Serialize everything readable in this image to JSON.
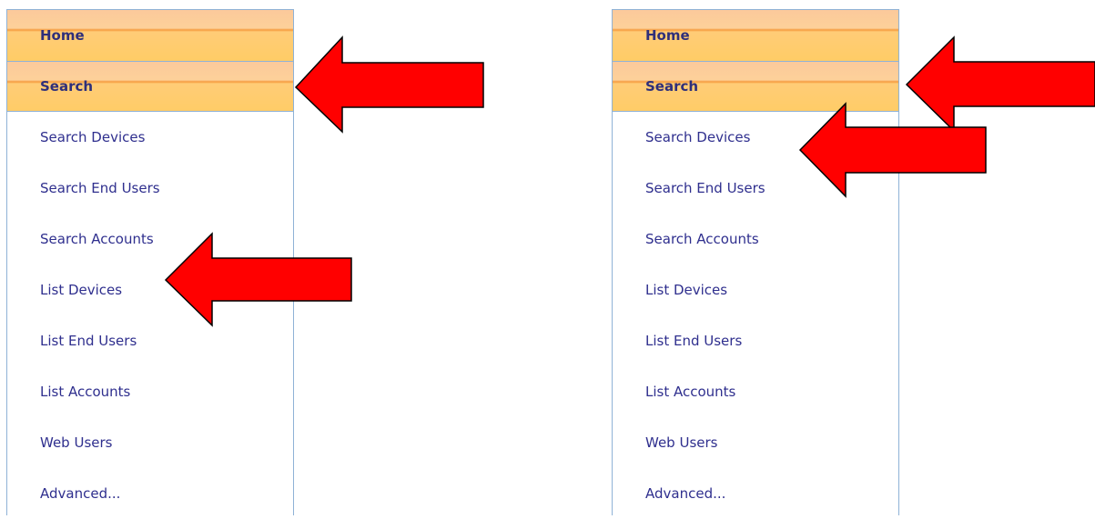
{
  "left_menu": {
    "headers": [
      {
        "label": "Home"
      },
      {
        "label": "Search"
      }
    ],
    "items": [
      {
        "label": "Search Devices"
      },
      {
        "label": "Search End Users"
      },
      {
        "label": "Search Accounts"
      },
      {
        "label": "List Devices"
      },
      {
        "label": "List End Users"
      },
      {
        "label": "List Accounts"
      },
      {
        "label": "Web Users"
      },
      {
        "label": "Advanced..."
      }
    ]
  },
  "right_menu": {
    "headers": [
      {
        "label": "Home"
      },
      {
        "label": "Search"
      }
    ],
    "items": [
      {
        "label": "Search Devices"
      },
      {
        "label": "Search End Users"
      },
      {
        "label": "Search Accounts"
      },
      {
        "label": "List Devices"
      },
      {
        "label": "List End Users"
      },
      {
        "label": "List Accounts"
      },
      {
        "label": "Web Users"
      },
      {
        "label": "Advanced..."
      }
    ]
  },
  "colors": {
    "arrow_fill": "#ff0000",
    "arrow_stroke": "#000000",
    "menu_border": "#8fb2d6",
    "header_text": "#2f2f7a",
    "link_text": "#2f2f8e"
  }
}
